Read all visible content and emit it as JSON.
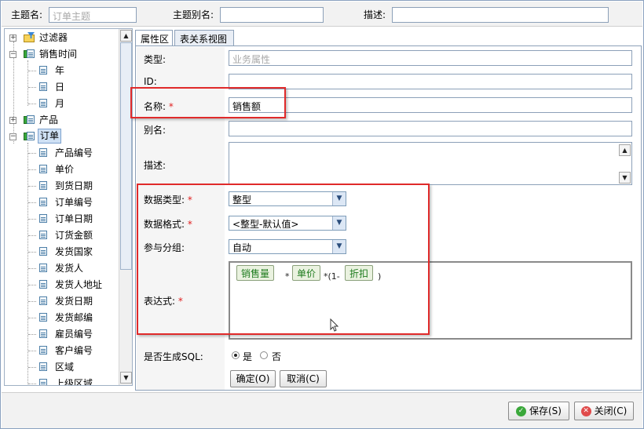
{
  "header": {
    "subject_label": "主题名:",
    "subject_placeholder": "订单主题",
    "alias_label": "主题别名:",
    "alias_value": "",
    "desc_label": "描述:",
    "desc_value": ""
  },
  "tree": {
    "items": [
      {
        "label": "过滤器",
        "icon": "filter-folder-icon",
        "expand": "+"
      },
      {
        "label": "销售时间",
        "icon": "dimension-icon",
        "expand": "-"
      },
      {
        "label": "年",
        "icon": "field-icon"
      },
      {
        "label": "日",
        "icon": "field-icon"
      },
      {
        "label": "月",
        "icon": "field-icon"
      },
      {
        "label": "产品",
        "icon": "dimension-icon",
        "expand": "+"
      },
      {
        "label": "订单",
        "icon": "dimension-icon",
        "expand": "-"
      },
      {
        "label": "产品编号",
        "icon": "field-icon"
      },
      {
        "label": "单价",
        "icon": "field-icon"
      },
      {
        "label": "到货日期",
        "icon": "field-icon"
      },
      {
        "label": "订单编号",
        "icon": "field-icon"
      },
      {
        "label": "订单日期",
        "icon": "field-icon"
      },
      {
        "label": "订货金额",
        "icon": "field-icon"
      },
      {
        "label": "发货国家",
        "icon": "field-icon"
      },
      {
        "label": "发货人",
        "icon": "field-icon"
      },
      {
        "label": "发货人地址",
        "icon": "field-icon"
      },
      {
        "label": "发货日期",
        "icon": "field-icon"
      },
      {
        "label": "发货邮编",
        "icon": "field-icon"
      },
      {
        "label": "雇员编号",
        "icon": "field-icon"
      },
      {
        "label": "客户编号",
        "icon": "field-icon"
      },
      {
        "label": "区域",
        "icon": "field-icon"
      },
      {
        "label": "上级区域",
        "icon": "field-icon"
      }
    ]
  },
  "tabs": [
    {
      "label": "属性区"
    },
    {
      "label": "表关系视图"
    }
  ],
  "form": {
    "type_label": "类型:",
    "type_value": "业务属性",
    "id_label": "ID:",
    "id_value": "",
    "name_label": "名称:",
    "name_value": "销售额",
    "alias_label": "别名:",
    "alias_value": "",
    "desc_label": "描述:",
    "desc_value": "",
    "datatype_label": "数据类型:",
    "datatype_value": "整型",
    "format_label": "数据格式:",
    "format_value": "<整型-默认值>",
    "group_label": "参与分组:",
    "group_value": "自动",
    "expr_label": "表达式:",
    "required_mark": "*",
    "sql_label": "是否生成SQL:",
    "sql_yes": "是",
    "sql_no": "否",
    "confirm_button": "确定(O)",
    "cancel_button": "取消(C)"
  },
  "expression": {
    "field1": "销售量",
    "op1": "*",
    "field2": "单价",
    "op2": "*(1-",
    "field3": "折扣",
    "op3": ")"
  },
  "footer": {
    "save_button": "保存(S)",
    "close_button": "关闭(C)"
  },
  "colors": {
    "highlight_box": "#e02a2a",
    "required": "#e02020",
    "chip_text": "#1d7b1d"
  }
}
